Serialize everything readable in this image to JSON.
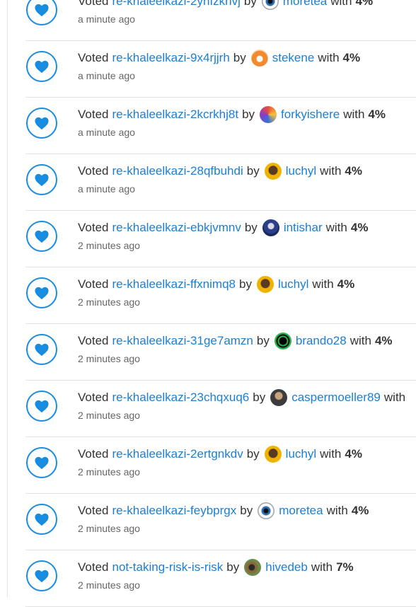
{
  "feed": [
    {
      "action": "Voted",
      "post": "re-khaleelkazi-2yhfzknvj",
      "by": "by",
      "user": "moretea",
      "with": "with",
      "pct": "4%",
      "time": "a minute ago",
      "avatar": "av-eye"
    },
    {
      "action": "Voted",
      "post": "re-khaleelkazi-9x4rjjrh",
      "by": "by",
      "user": "stekene",
      "with": "with",
      "pct": "4%",
      "time": "a minute ago",
      "avatar": "av-fox"
    },
    {
      "action": "Voted",
      "post": "re-khaleelkazi-2kcrkhj8t",
      "by": "by",
      "user": "forkyishere",
      "with": "with",
      "pct": "4%",
      "time": "a minute ago",
      "avatar": "av-cat"
    },
    {
      "action": "Voted",
      "post": "re-khaleelkazi-28qfbuhdi",
      "by": "by",
      "user": "luchyl",
      "with": "with",
      "pct": "4%",
      "time": "a minute ago",
      "avatar": "av-woman"
    },
    {
      "action": "Voted",
      "post": "re-khaleelkazi-ebkjvmnv",
      "by": "by",
      "user": "intishar",
      "with": "with",
      "pct": "4%",
      "time": "2 minutes ago",
      "avatar": "av-blue"
    },
    {
      "action": "Voted",
      "post": "re-khaleelkazi-ffxnimq8",
      "by": "by",
      "user": "luchyl",
      "with": "with",
      "pct": "4%",
      "time": "2 minutes ago",
      "avatar": "av-woman"
    },
    {
      "action": "Voted",
      "post": "re-khaleelkazi-31ge7amzn",
      "by": "by",
      "user": "brando28",
      "with": "with",
      "pct": "4%",
      "time": "2 minutes ago",
      "avatar": "av-ring"
    },
    {
      "action": "Voted",
      "post": "re-khaleelkazi-23chqxuq6",
      "by": "by",
      "user": "caspermoeller89",
      "with": "with",
      "pct": "",
      "time": "2 minutes ago",
      "avatar": "av-man"
    },
    {
      "action": "Voted",
      "post": "re-khaleelkazi-2ertgnkdv",
      "by": "by",
      "user": "luchyl",
      "with": "with",
      "pct": "4%",
      "time": "2 minutes ago",
      "avatar": "av-woman"
    },
    {
      "action": "Voted",
      "post": "re-khaleelkazi-feybprgx",
      "by": "by",
      "user": "moretea",
      "with": "with",
      "pct": "4%",
      "time": "2 minutes ago",
      "avatar": "av-eye"
    },
    {
      "action": "Voted",
      "post": "not-taking-risk-is-risk",
      "by": "by",
      "user": "hivedeb",
      "with": "with",
      "pct": "7%",
      "time": "2 minutes ago",
      "avatar": "av-bee"
    }
  ],
  "colors": {
    "accent": "#1a8ce0",
    "link": "#1a7fd4",
    "text": "#333333",
    "muted": "#666666"
  },
  "icons": {
    "vote": "heart-icon"
  }
}
